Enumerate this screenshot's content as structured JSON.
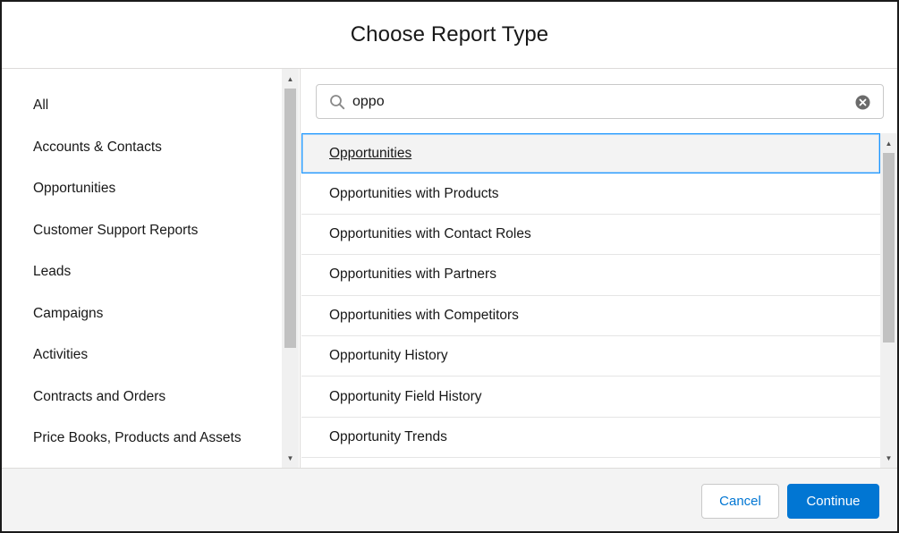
{
  "header": {
    "title": "Choose Report Type"
  },
  "categories": [
    {
      "label": "All"
    },
    {
      "label": "Accounts & Contacts"
    },
    {
      "label": "Opportunities"
    },
    {
      "label": "Customer Support Reports"
    },
    {
      "label": "Leads"
    },
    {
      "label": "Campaigns"
    },
    {
      "label": "Activities"
    },
    {
      "label": "Contracts and Orders"
    },
    {
      "label": "Price Books, Products and Assets"
    }
  ],
  "search": {
    "value": "oppo",
    "placeholder": ""
  },
  "results": [
    {
      "label": "Opportunities",
      "selected": true
    },
    {
      "label": "Opportunities with Products"
    },
    {
      "label": "Opportunities with Contact Roles"
    },
    {
      "label": "Opportunities with Partners"
    },
    {
      "label": "Opportunities with Competitors"
    },
    {
      "label": "Opportunity History"
    },
    {
      "label": "Opportunity Field History"
    },
    {
      "label": "Opportunity Trends"
    }
  ],
  "footer": {
    "cancel_label": "Cancel",
    "continue_label": "Continue"
  },
  "colors": {
    "brand": "#0176d3",
    "selected_border": "#1b96ff",
    "selected_bg": "#f3f3f3"
  },
  "icons": {
    "search": "search-icon",
    "clear": "clear-icon",
    "scroll_up": "scroll-up-arrow-icon",
    "scroll_down": "scroll-down-arrow-icon"
  }
}
